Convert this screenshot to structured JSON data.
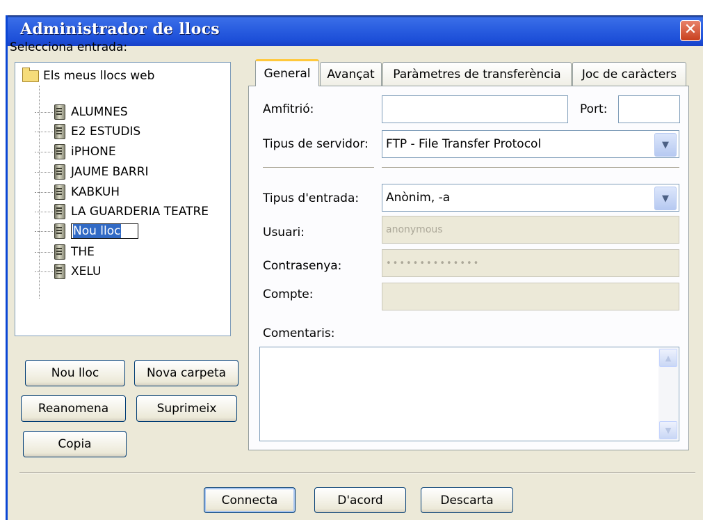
{
  "window": {
    "title": "Administrador de llocs",
    "close_glyph": "✕"
  },
  "left": {
    "select_label": "Selecciona entrada:",
    "tree": {
      "root": "Els meus llocs web",
      "items": [
        "ALUMNES",
        "E2 ESTUDIS",
        "iPHONE",
        "JAUME BARRI",
        "KABKUH",
        "LA GUARDERIA TEATRE",
        "Nou lloc",
        "THE",
        "XELU"
      ],
      "selected": "Nou lloc"
    },
    "buttons": {
      "new_site": "Nou lloc",
      "new_folder": "Nova carpeta",
      "rename": "Reanomena",
      "delete": "Suprimeix",
      "copy": "Copia"
    }
  },
  "tabs": [
    "General",
    "Avançat",
    "Paràmetres de transferència",
    "Joc de caràcters"
  ],
  "active_tab": "General",
  "general": {
    "host_label": "Amfitrió:",
    "host_value": "",
    "port_label": "Port:",
    "port_value": "",
    "server_type_label": "Tipus de servidor:",
    "server_type_value": "FTP - File Transfer Protocol",
    "logon_type_label": "Tipus d'entrada:",
    "logon_type_value": "Anònim, -a",
    "user_label": "Usuari:",
    "user_value": "anonymous",
    "password_label": "Contrasenya:",
    "password_value": "••••••••••••••",
    "account_label": "Compte:",
    "account_value": "",
    "comments_label": "Comentaris:",
    "comments_value": ""
  },
  "footer": {
    "connect": "Connecta",
    "ok": "D'acord",
    "cancel": "Descarta"
  },
  "icons": {
    "folder": "folder-open-icon",
    "server": "server-icon",
    "dropdown": "chevron-down-icon",
    "close": "close-icon"
  },
  "colors": {
    "title_bar": "#2a5ee0",
    "selection": "#316ac5",
    "active_tab_accent": "#ffc83c",
    "window_bg": "#ece9d8"
  }
}
